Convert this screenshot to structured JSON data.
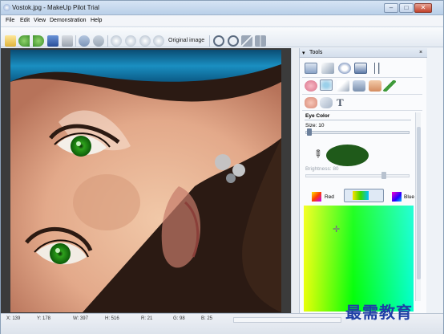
{
  "window": {
    "title": "Vostok.jpg - MakeUp Pilot Trial",
    "min": "–",
    "max": "□",
    "close": "✕"
  },
  "menu": [
    "File",
    "Edit",
    "View",
    "Demonstration",
    "Help"
  ],
  "toolbar": {
    "original_image": "Original image"
  },
  "tools_panel": {
    "title": "Tools",
    "pin": "▾",
    "close": "×",
    "section": "Eye Color",
    "size_label": "Size: 10",
    "size_value": 10,
    "brightness_label": "Brightness: 80",
    "brightness_value": 80,
    "color_swatch": "#1f5a1a",
    "mode_red": "Red",
    "mode_blue": "Blue"
  },
  "status": {
    "x": "X: 139",
    "y": "Y: 178",
    "w": "W: 397",
    "h": "H: 516",
    "r": "R: 21",
    "g": "G: 98",
    "b": "B: 25"
  },
  "watermark": "最需教育",
  "colors": {
    "accent": "#3d6fb0",
    "eye_color": "#1f5a1a"
  }
}
